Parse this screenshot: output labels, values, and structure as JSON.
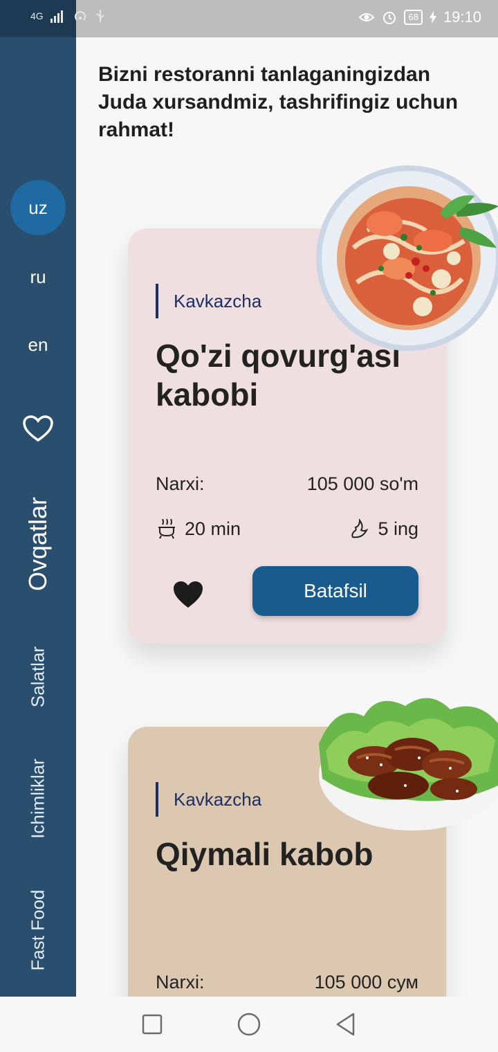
{
  "status_bar": {
    "network": "4G",
    "icons_left": [
      "signal-icon",
      "hotspot-icon",
      "usb-icon"
    ],
    "icons_right": [
      "eye-icon",
      "alarm-icon",
      "battery-icon",
      "charging-icon"
    ],
    "battery": "68",
    "time": "19:10"
  },
  "sidebar": {
    "languages": [
      {
        "code": "uz",
        "active": true
      },
      {
        "code": "ru",
        "active": false
      },
      {
        "code": "en",
        "active": false
      }
    ],
    "favorites_icon": "heart-outline-icon",
    "categories": [
      "Ovqatlar",
      "Salatlar",
      "Ichimliklar",
      "Fast Food"
    ],
    "active_category": "Ovqatlar"
  },
  "header": {
    "welcome": "Bizni restoranni tanlaganingizdan Juda xursandmiz, tashrifingiz uchun rahmat!"
  },
  "cards": [
    {
      "category": "Kavkazcha",
      "title": "Qo'zi qovurg'asi kabobi",
      "price_label": "Narxi:",
      "price": "105 000 so'm",
      "time": "20 min",
      "ingredients": "5 ing",
      "button": "Batafsil",
      "background": "#f0dfe0",
      "image": "noodle-soup-bowl"
    },
    {
      "category": "Kavkazcha",
      "title": "Qiymali kabob",
      "price_label": "Narxi:",
      "price": "105 000 сум",
      "background": "#dcc8b1",
      "image": "glazed-ribs-plate"
    }
  ],
  "colors": {
    "sidebar": "#2a4f6e",
    "active_lang": "#1f6aa3",
    "button": "#1a5b8e",
    "category_accent": "#1c2f63"
  }
}
